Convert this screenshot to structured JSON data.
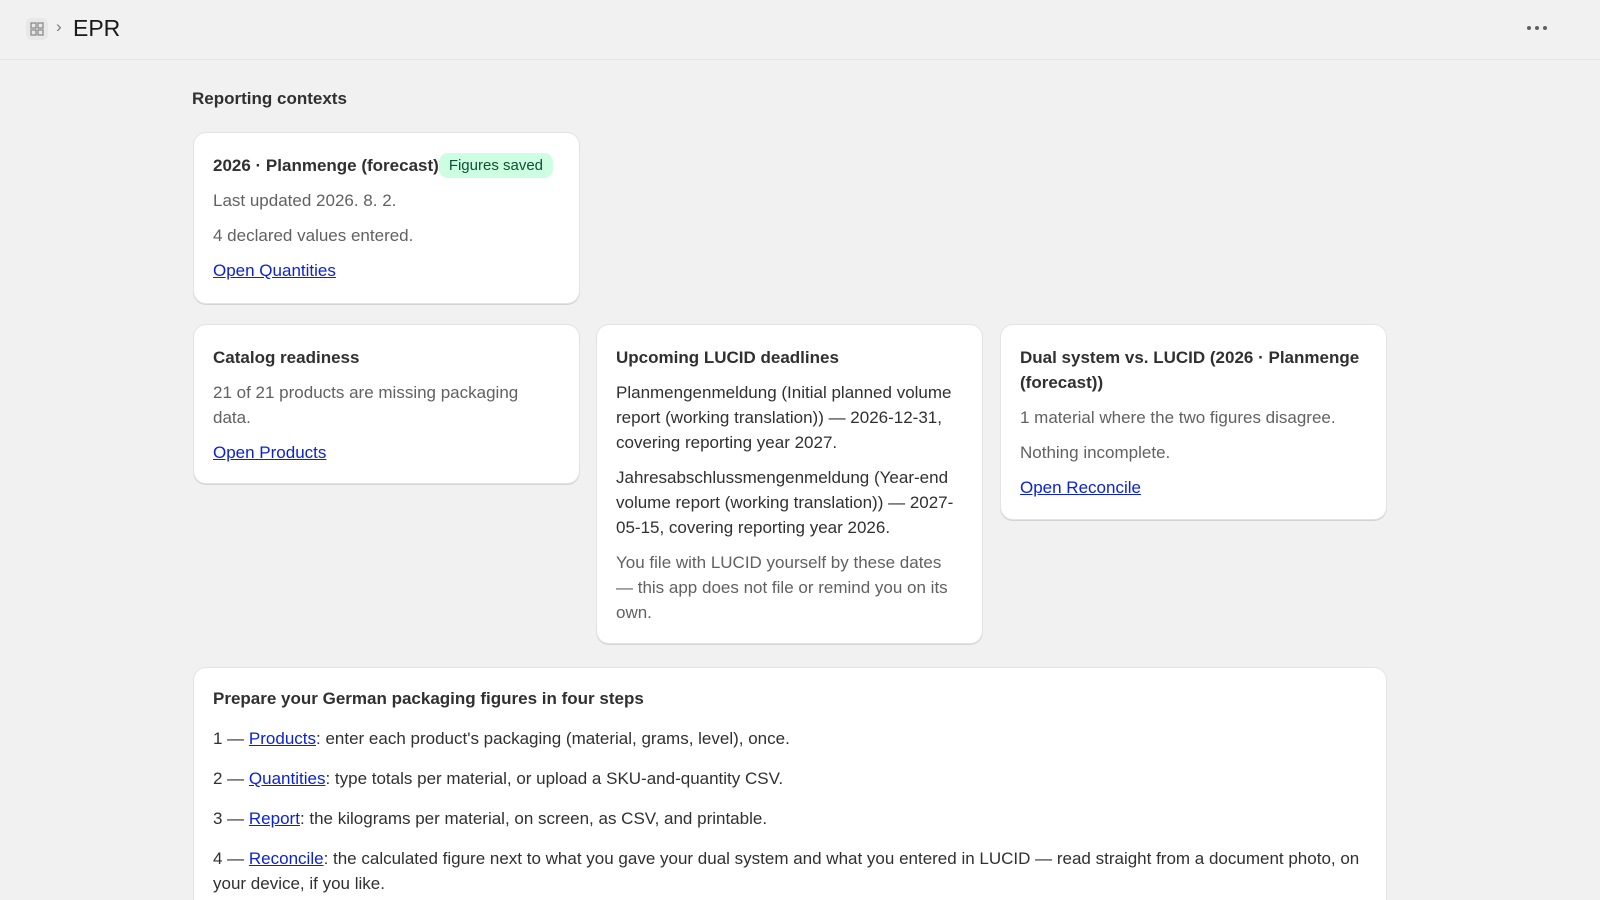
{
  "header": {
    "app_icon": "apps-grid-icon",
    "separator_icon": "chevron-right-icon",
    "title": "EPR",
    "more_icon": "ellipsis-icon"
  },
  "main": {
    "section_title": "Reporting contexts",
    "context_card": {
      "title": "2026 · Planmenge (forecast)",
      "badge": "Figures saved",
      "updated": "Last updated 2026. 8. 2.",
      "values": "4 declared values entered.",
      "link": "Open Quantities"
    },
    "catalog_card": {
      "title": "Catalog readiness",
      "text": "21 of 21 products are missing packaging data.",
      "link": "Open Products"
    },
    "deadlines_card": {
      "title": "Upcoming LUCID deadlines",
      "item1": "Planmengenmeldung (Initial planned volume report (working translation)) — 2026-12-31, covering reporting year 2027.",
      "item2": "Jahresabschlussmengenmeldung (Year-end volume report (working translation)) — 2027-05-15, covering reporting year 2026.",
      "note": "You file with LUCID yourself by these dates — this app does not file or remind you on its own."
    },
    "dual_card": {
      "title": "Dual system vs. LUCID (2026 · Planmenge (forecast))",
      "text1": "1 material where the two figures disagree.",
      "text2": "Nothing incomplete.",
      "link": "Open Reconcile"
    },
    "steps_card": {
      "title": "Prepare your German packaging figures in four steps",
      "steps": [
        {
          "prefix": "1 — ",
          "link": "Products",
          "text": ": enter each product's packaging (material, grams, level), once."
        },
        {
          "prefix": "2 — ",
          "link": "Quantities",
          "text": ": type totals per material, or upload a SKU-and-quantity CSV."
        },
        {
          "prefix": "3 — ",
          "link": "Report",
          "text": ": the kilograms per material, on screen, as CSV, and printable."
        },
        {
          "prefix": "4 — ",
          "link": "Reconcile",
          "text": ": the calculated figure next to what you gave your dual system and what you entered in LUCID — read straight from a document photo, on your device, if you like."
        }
      ]
    }
  }
}
